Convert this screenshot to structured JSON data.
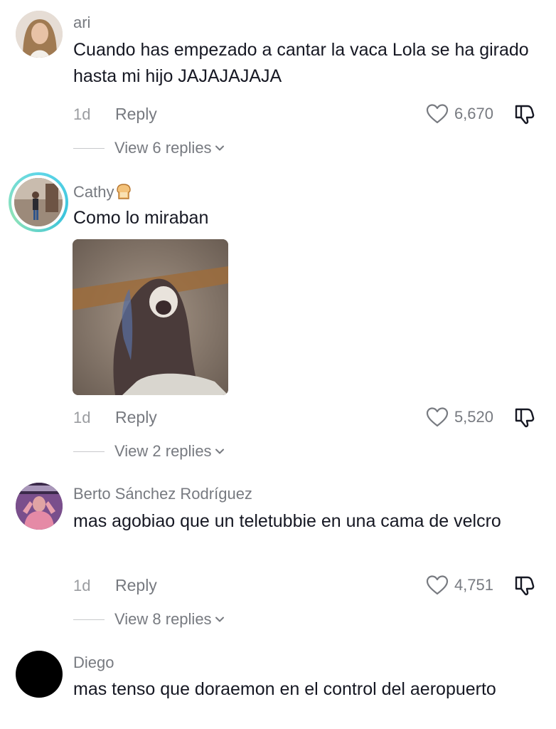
{
  "comments": [
    {
      "username": "ari",
      "text": "Cuando has empezado a cantar la vaca Lola se ha girado hasta mi hijo JAJAJAJAJA",
      "time": "1d",
      "reply_label": "Reply",
      "likes": "6,670",
      "view_replies": "View 6 replies"
    },
    {
      "username": "Cathy",
      "username_emoji": "bread-emoji",
      "text": "Como lo miraban",
      "has_image": true,
      "time": "1d",
      "reply_label": "Reply",
      "likes": "5,520",
      "view_replies": "View 2 replies"
    },
    {
      "username": "Berto Sánchez Rodríguez",
      "text": "mas agobiao que un teletubbie en una cama de velcro",
      "time": "1d",
      "reply_label": "Reply",
      "likes": "4,751",
      "view_replies": "View 8 replies"
    },
    {
      "username": "Diego",
      "text": "mas tenso que doraemon en el control del aeropuerto"
    }
  ],
  "colors": {
    "text_primary": "#161823",
    "text_secondary": "#777a80",
    "story_ring": "#3bc4dc",
    "background": "#ffffff"
  },
  "icons": {
    "like": "heart-icon",
    "dislike": "dislike-icon",
    "expand": "chevron-down-icon"
  }
}
